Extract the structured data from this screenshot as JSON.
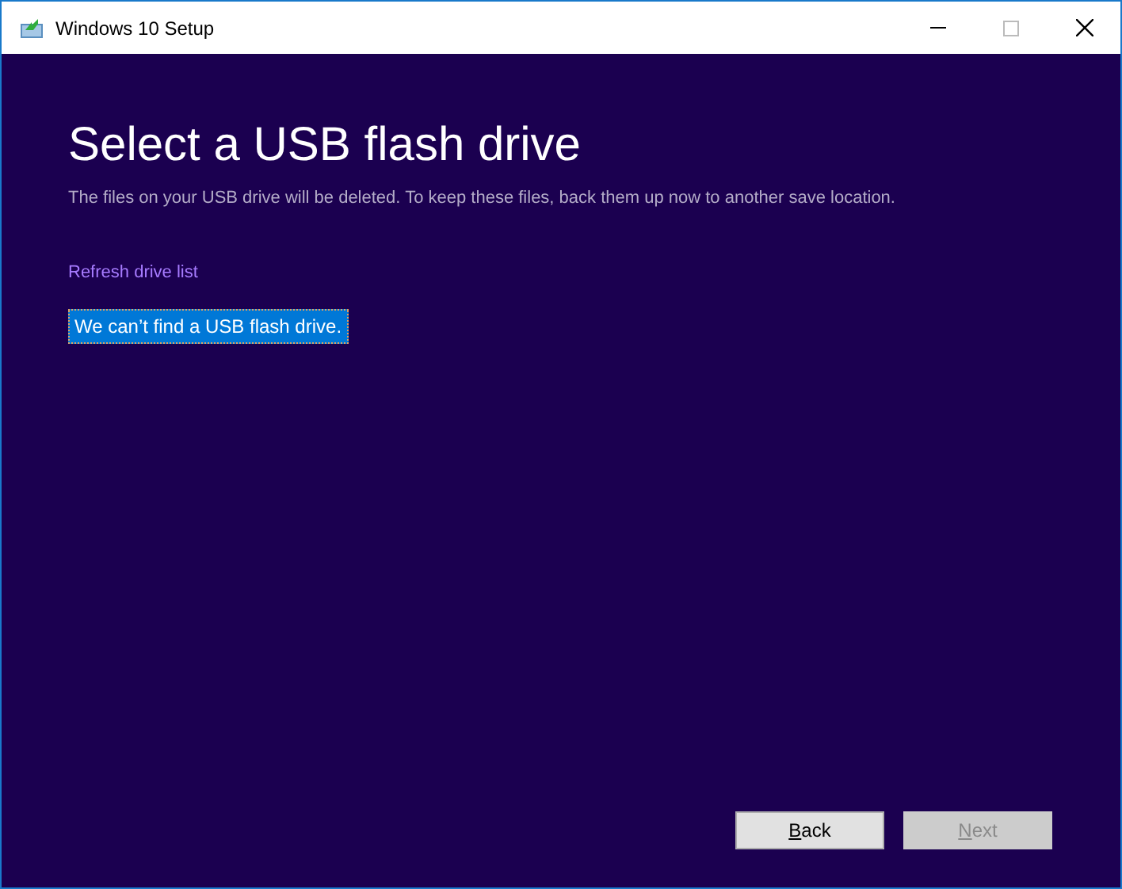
{
  "window": {
    "title": "Windows 10 Setup"
  },
  "heading": "Select a USB flash drive",
  "subtitle": "The files on your USB drive will be deleted. To keep these files, back them up now to another save location.",
  "refresh_link": "Refresh drive list",
  "drives": [
    {
      "label": "We can’t find a USB flash drive.",
      "selected": true
    }
  ],
  "buttons": [
    {
      "label": "Back",
      "disabled": false
    },
    {
      "label": "Next",
      "disabled": true
    }
  ]
}
